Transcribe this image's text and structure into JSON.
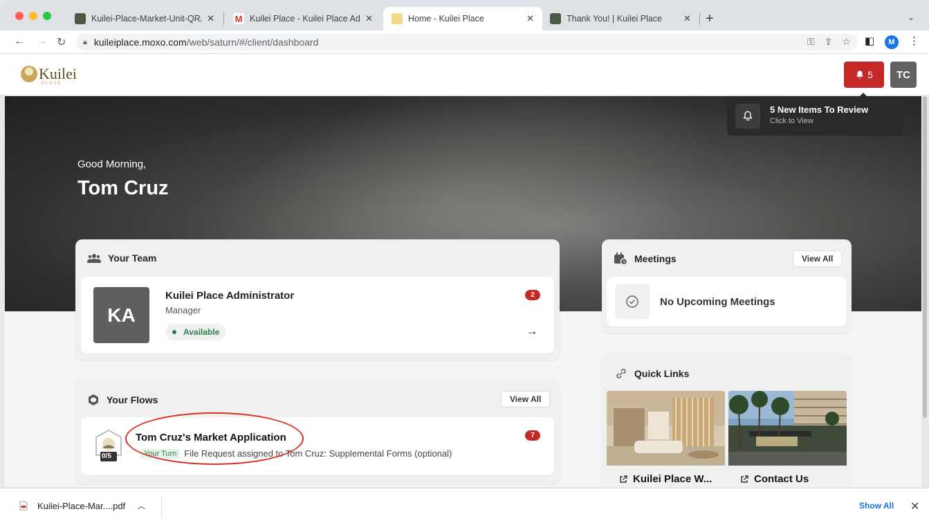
{
  "browser": {
    "tabs": [
      {
        "label": "Kuilei-Place-Market-Unit-QRA",
        "active": false
      },
      {
        "label": "Kuilei Place - Kuilei Place Adm",
        "active": false
      },
      {
        "label": "Home - Kuilei Place",
        "active": true
      },
      {
        "label": "Thank You! | Kuilei Place",
        "active": false
      }
    ],
    "url_host": "kuileiplace.moxo.com",
    "url_path": "/web/saturn/#/client/dashboard",
    "profile_initial": "M"
  },
  "header": {
    "logo_text": "Kuilei",
    "logo_sub": "PLACE",
    "notification_count": "5",
    "user_initials": "TC"
  },
  "notification": {
    "title": "5 New Items To Review",
    "subtitle": "Click to View"
  },
  "hero": {
    "greeting": "Good Morning,",
    "name": "Tom Cruz"
  },
  "team": {
    "title": "Your Team",
    "member": {
      "initials": "KA",
      "name": "Kuilei Place Administrator",
      "role": "Manager",
      "status": "Available",
      "badge": "2"
    }
  },
  "flows": {
    "title": "Your Flows",
    "view_all": "View All",
    "item": {
      "title": "Tom Cruz's Market Application",
      "progress": "0/5",
      "turn_tag": "Your Turn",
      "description": "File Request assigned to Tom Cruz: Supplemental Forms (optional)",
      "badge": "7"
    }
  },
  "meetings": {
    "title": "Meetings",
    "view_all": "View All",
    "empty_text": "No Upcoming Meetings"
  },
  "quick_links": {
    "title": "Quick Links",
    "links": [
      {
        "label": "Kuilei Place W..."
      },
      {
        "label": "Contact Us"
      }
    ]
  },
  "downloads": {
    "file": "Kuilei-Place-Mar....pdf",
    "show_all": "Show All"
  },
  "colors": {
    "alert_red": "#c62828",
    "status_green": "#2e7d4f",
    "annotation_red": "#d93025"
  }
}
